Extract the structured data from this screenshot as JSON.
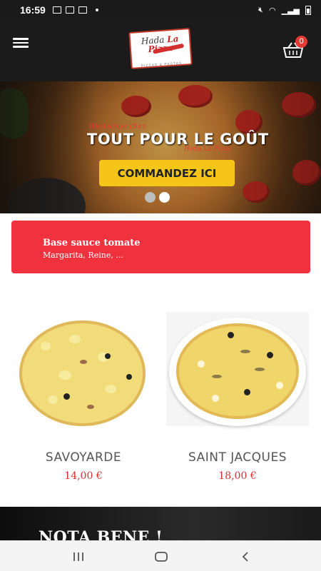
{
  "status_bar": {
    "time": "16:59"
  },
  "header": {
    "logo_text_1": "Hada",
    "logo_text_2": "La Pizza",
    "logo_sub": "PIZZAS & PASTAS",
    "cart_count": "0"
  },
  "hero": {
    "welcome": "Bienvenue chez",
    "title": "TOUT POUR LE GOÛT",
    "brand": "Hada La Pizza",
    "cta": "COMMANDEZ ICI"
  },
  "category": {
    "title": "Base sauce tomate",
    "subtitle": "Margarita, Reine, ..."
  },
  "products": [
    {
      "name": "SAVOYARDE",
      "price": "14,00 €"
    },
    {
      "name": "SAINT JACQUES",
      "price": "18,00 €"
    }
  ],
  "notabene": {
    "title": "NOTA BENE !"
  },
  "colors": {
    "accent_red": "#f0323f",
    "cta_yellow": "#f5c518",
    "price_red": "#d32f2f",
    "header_bg": "#1b1b1b"
  }
}
